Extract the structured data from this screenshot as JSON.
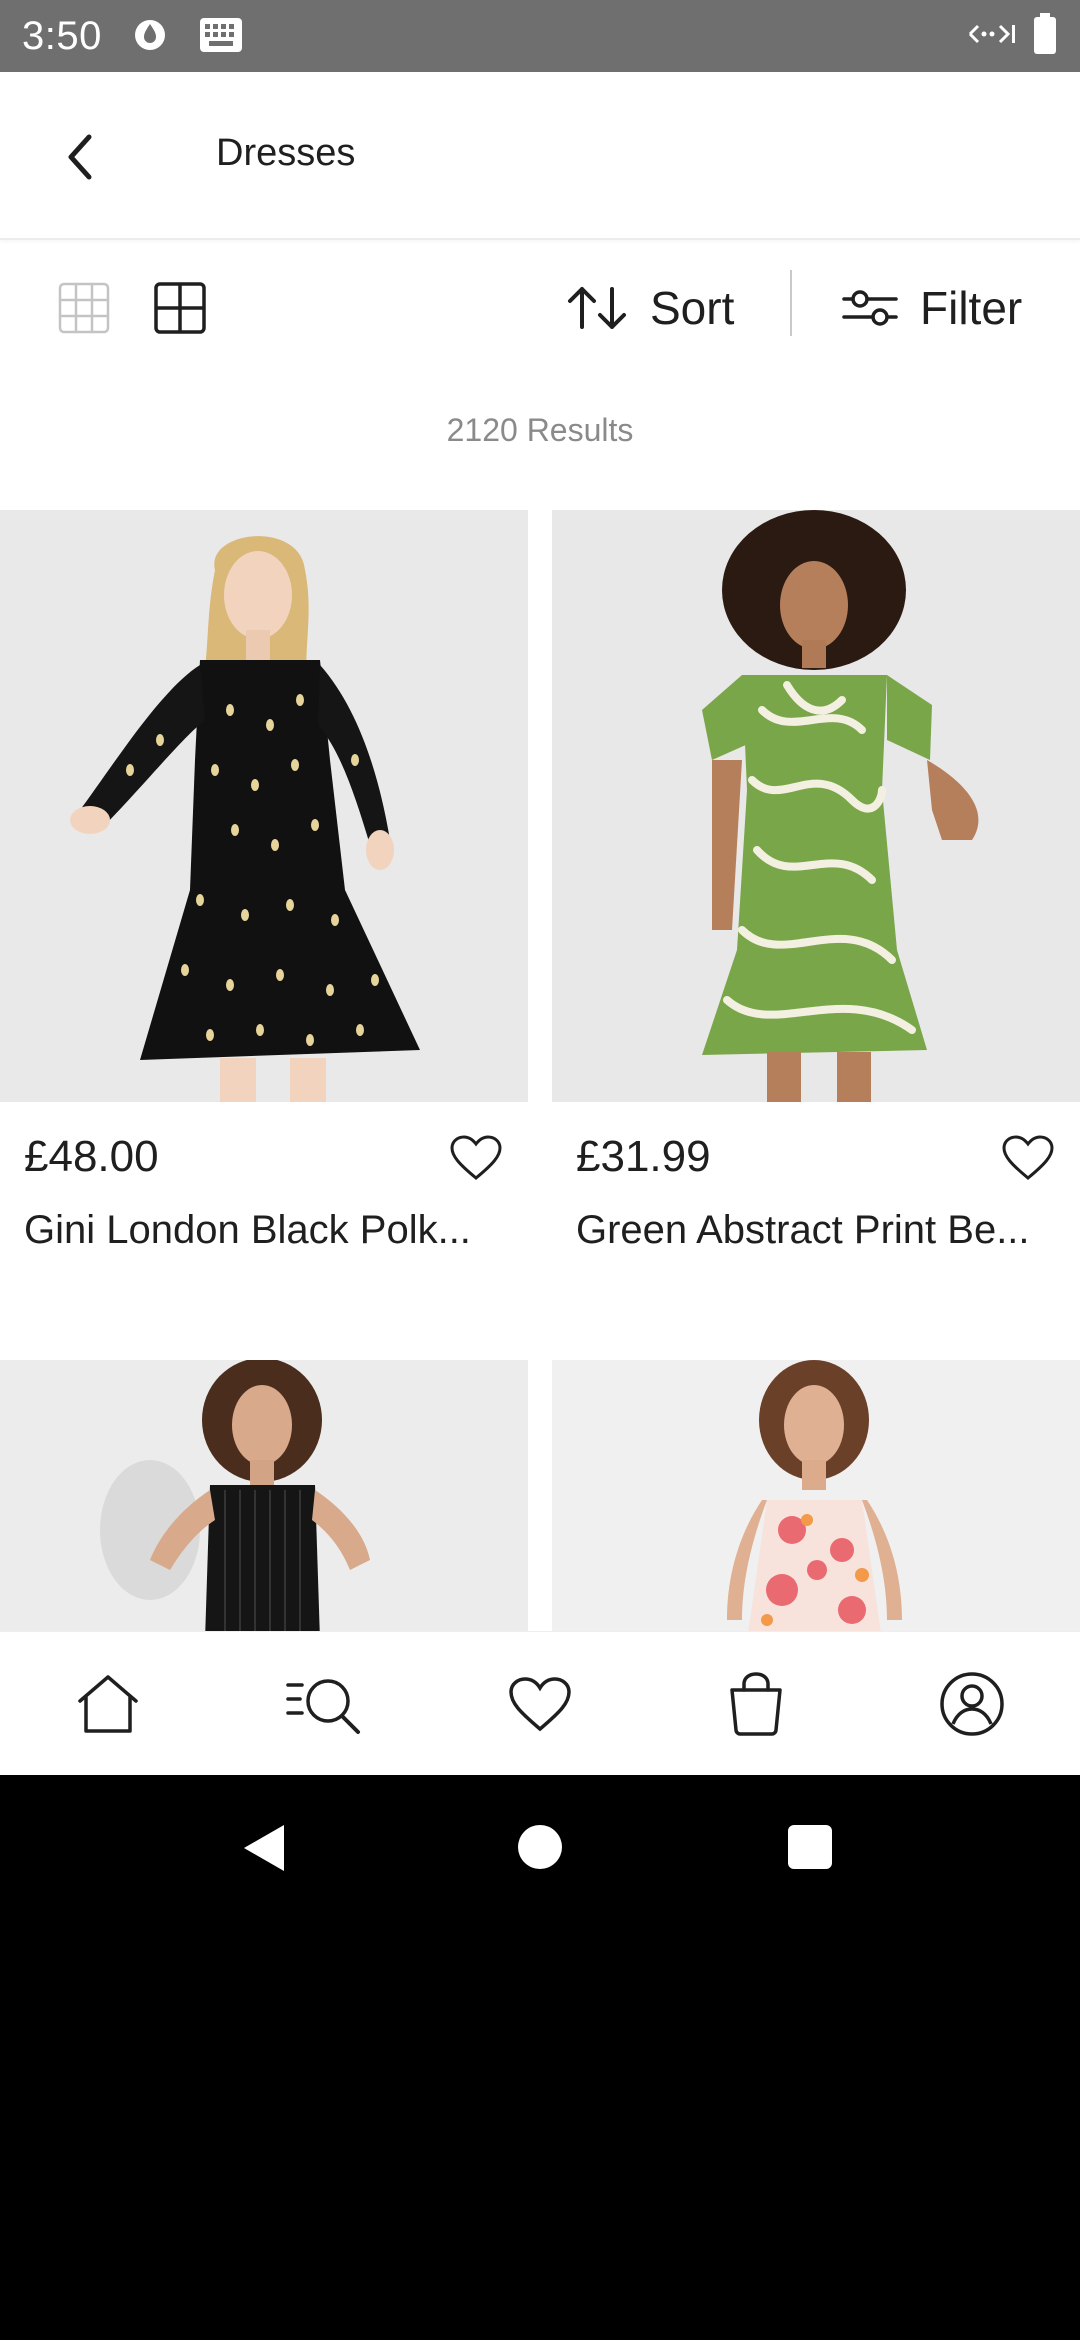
{
  "status_bar": {
    "time": "3:50",
    "icons": [
      "water-drop-icon",
      "keyboard-icon",
      "signal-icon",
      "battery-icon"
    ]
  },
  "header": {
    "title": "Dresses",
    "back_icon": "chevron-left-icon"
  },
  "toolbar": {
    "sort_label": "Sort",
    "filter_label": "Filter",
    "view_options": [
      "grid-3x3-icon",
      "grid-2x2-icon"
    ],
    "active_view": "grid-2x2"
  },
  "results": {
    "count_text": "2120 Results"
  },
  "products": [
    {
      "price": "£48.00",
      "name": "Gini London Black Polk...",
      "image_desc_colors": [
        "#000000",
        "#e6d49a"
      ],
      "wishlisted": false
    },
    {
      "price": "£31.99",
      "name": "Green Abstract Print Be...",
      "image_desc_colors": [
        "#7aa64a",
        "#f3f0e2"
      ],
      "wishlisted": false
    },
    {
      "price": "",
      "name": "",
      "wishlisted": false
    },
    {
      "price": "",
      "name": "",
      "wishlisted": false
    }
  ],
  "bottom_nav": {
    "items": [
      "home-icon",
      "search-list-icon",
      "heart-icon",
      "bag-icon",
      "account-icon"
    ]
  },
  "colors": {
    "status_bar_bg": "#6f6f6f",
    "text_primary": "#1f1f1f",
    "text_secondary": "#8a8a8a",
    "divider": "#c9c9c9"
  }
}
